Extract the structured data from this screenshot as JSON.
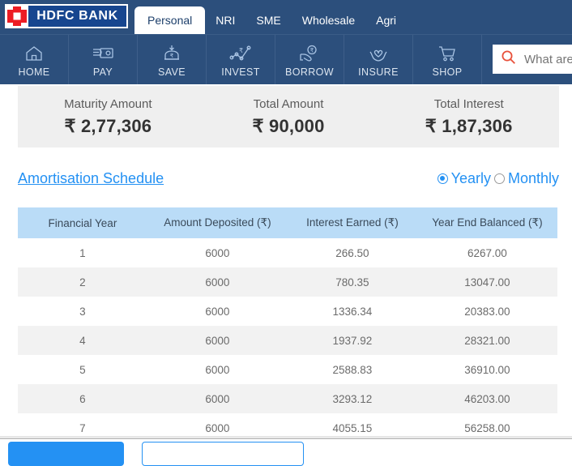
{
  "header": {
    "logo": {
      "icon": "hdfc-logo-icon",
      "text": "HDFC BANK"
    },
    "tabs": [
      {
        "label": "Personal",
        "active": true
      },
      {
        "label": "NRI",
        "active": false
      },
      {
        "label": "SME",
        "active": false
      },
      {
        "label": "Wholesale",
        "active": false
      },
      {
        "label": "Agri",
        "active": false
      }
    ],
    "nav": [
      {
        "label": "HOME",
        "icon": "home-icon"
      },
      {
        "label": "PAY",
        "icon": "pay-card-hand-icon"
      },
      {
        "label": "SAVE",
        "icon": "save-piggy-rupee-icon"
      },
      {
        "label": "INVEST",
        "icon": "invest-growth-chart-icon"
      },
      {
        "label": "BORROW",
        "icon": "borrow-hand-coin-icon"
      },
      {
        "label": "INSURE",
        "icon": "insure-hands-heart-icon"
      },
      {
        "label": "SHOP",
        "icon": "shop-cart-icon"
      }
    ],
    "search": {
      "icon": "search-icon",
      "value": "",
      "placeholder": "What are you looking for?"
    }
  },
  "summary": [
    {
      "label": "Maturity Amount",
      "value": "₹ 2,77,306"
    },
    {
      "label": "Total Amount",
      "value": "₹ 90,000"
    },
    {
      "label": "Total Interest",
      "value": "₹ 1,87,306"
    }
  ],
  "schedule": {
    "title": "Amortisation Schedule",
    "frequency": {
      "selected": "Yearly",
      "options": [
        {
          "label": "Yearly",
          "selected": true
        },
        {
          "label": "Monthly",
          "selected": false
        }
      ]
    },
    "columns": [
      "Financial Year",
      "Amount Deposited (₹)",
      "Interest Earned (₹)",
      "Year End Balanced (₹)"
    ],
    "rows": [
      [
        "1",
        "6000",
        "266.50",
        "6267.00"
      ],
      [
        "2",
        "6000",
        "780.35",
        "13047.00"
      ],
      [
        "3",
        "6000",
        "1336.34",
        "20383.00"
      ],
      [
        "4",
        "6000",
        "1937.92",
        "28321.00"
      ],
      [
        "5",
        "6000",
        "2588.83",
        "36910.00"
      ],
      [
        "6",
        "6000",
        "3293.12",
        "46203.00"
      ],
      [
        "7",
        "6000",
        "4055.15",
        "56258.00"
      ]
    ]
  },
  "footer": {
    "primary_label": "",
    "secondary_label": ""
  },
  "colors": {
    "navy": "#2c4f7c",
    "accent_blue": "#2491f3",
    "logo_red": "#ed1c24",
    "logo_blue": "#17468f",
    "table_header": "#badcf7",
    "card_gray": "#efefef",
    "row_alt": "#f2f2f2"
  }
}
